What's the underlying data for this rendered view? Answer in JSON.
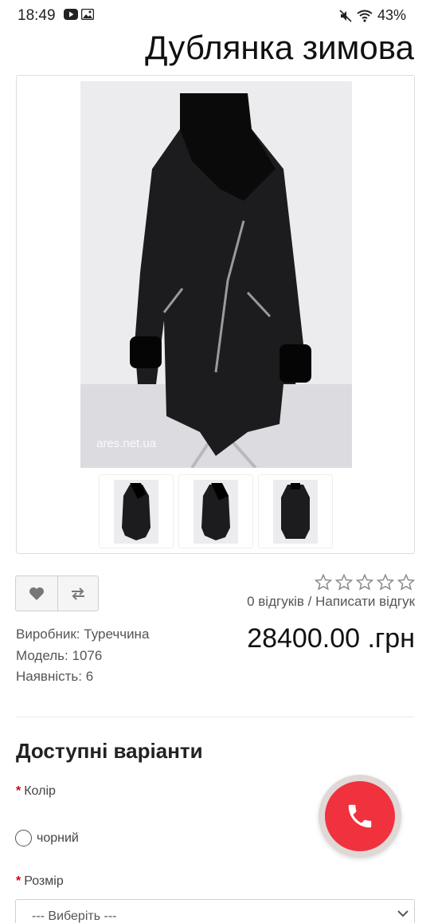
{
  "status_bar": {
    "time": "18:49",
    "battery": "43%",
    "left_icons": [
      "youtube-icon",
      "gallery-icon"
    ],
    "right_icons": [
      "mute-icon",
      "wifi-icon"
    ]
  },
  "product": {
    "title": "Дублянка зимова",
    "watermark": "ares.net.ua",
    "thumbnails": 3,
    "rating": {
      "stars_total": 5,
      "stars_filled": 0
    },
    "reviews_text": "0 відгуків / Написати відгук",
    "manufacturer_label": "Виробник:",
    "manufacturer": "Туреччина",
    "model_label": "Модель:",
    "model": "1076",
    "availability_label": "Наявність:",
    "availability": "6",
    "price": "28400.00 .грн"
  },
  "options": {
    "title": "Доступні варіанти",
    "color_label": "Колір",
    "color_choice": "чорний",
    "size_label": "Розмір",
    "size_placeholder": "--- Виберіть ---",
    "required_mark": "*"
  },
  "colors": {
    "call_button": "#f0323e",
    "required": "#d0021b"
  }
}
